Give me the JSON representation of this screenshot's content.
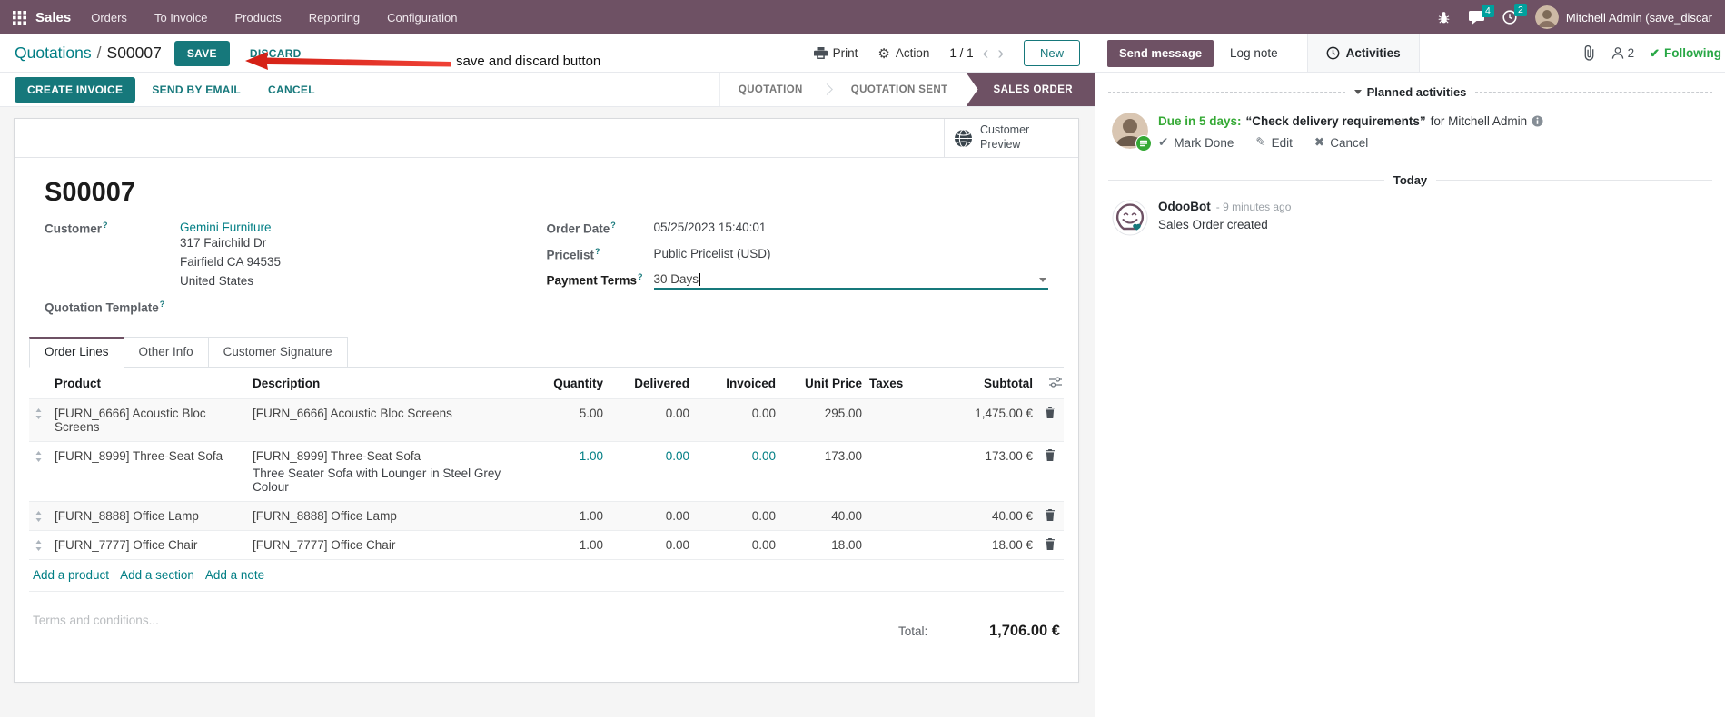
{
  "nav": {
    "app_label": "Sales",
    "menus": [
      {
        "label": "Orders"
      },
      {
        "label": "To Invoice"
      },
      {
        "label": "Products"
      },
      {
        "label": "Reporting"
      },
      {
        "label": "Configuration"
      }
    ],
    "messages_badge": "4",
    "activities_badge": "2",
    "user_name": "Mitchell Admin (save_discar"
  },
  "control": {
    "breadcrumb_parent": "Quotations",
    "breadcrumb_sep": "/",
    "breadcrumb_current": "S00007",
    "save": "SAVE",
    "discard": "DISCARD",
    "print": "Print",
    "action": "Action",
    "pager": "1 / 1",
    "new": "New"
  },
  "annotation": {
    "label": "save and discard button"
  },
  "actions": {
    "create_invoice": "CREATE INVOICE",
    "send_by_email": "SEND BY EMAIL",
    "cancel": "CANCEL"
  },
  "statusbar": {
    "step1": "QUOTATION",
    "step2": "QUOTATION SENT",
    "step3": "SALES ORDER"
  },
  "sheet": {
    "customer_preview": "Customer Preview",
    "name": "S00007",
    "help_marker": "?",
    "customer_label": "Customer",
    "customer": "Gemini Furniture",
    "address_line1": "317 Fairchild Dr",
    "address_line2": "Fairfield CA 94535",
    "address_line3": "United States",
    "quotation_template_label": "Quotation Template",
    "order_date_label": "Order Date",
    "order_date": "05/25/2023 15:40:01",
    "pricelist_label": "Pricelist",
    "pricelist": "Public Pricelist (USD)",
    "payment_terms_label": "Payment Terms",
    "payment_terms": "30 Days"
  },
  "tabs": {
    "order_lines": "Order Lines",
    "other_info": "Other Info",
    "customer_signature": "Customer Signature"
  },
  "order_lines": {
    "columns": {
      "product": "Product",
      "description": "Description",
      "quantity": "Quantity",
      "delivered": "Delivered",
      "invoiced": "Invoiced",
      "unit_price": "Unit Price",
      "taxes": "Taxes",
      "subtotal": "Subtotal"
    },
    "rows": [
      {
        "product": "[FURN_6666] Acoustic Bloc Screens",
        "description": "[FURN_6666] Acoustic Bloc Screens",
        "description2": "",
        "quantity": "5.00",
        "delivered": "0.00",
        "invoiced": "0.00",
        "unit_price": "295.00",
        "taxes": "",
        "subtotal": "1,475.00 €"
      },
      {
        "product": "[FURN_8999] Three-Seat Sofa",
        "description": "[FURN_8999] Three-Seat Sofa",
        "description2": "Three Seater Sofa with Lounger in Steel Grey Colour",
        "quantity": "1.00",
        "delivered": "0.00",
        "invoiced": "0.00",
        "unit_price": "173.00",
        "taxes": "",
        "subtotal": "173.00 €"
      },
      {
        "product": "[FURN_8888] Office Lamp",
        "description": "[FURN_8888] Office Lamp",
        "description2": "",
        "quantity": "1.00",
        "delivered": "0.00",
        "invoiced": "0.00",
        "unit_price": "40.00",
        "taxes": "",
        "subtotal": "40.00 €"
      },
      {
        "product": "[FURN_7777] Office Chair",
        "description": "[FURN_7777] Office Chair",
        "description2": "",
        "quantity": "1.00",
        "delivered": "0.00",
        "invoiced": "0.00",
        "unit_price": "18.00",
        "taxes": "",
        "subtotal": "18.00 €"
      }
    ],
    "add_product": "Add a product",
    "add_section": "Add a section",
    "add_note": "Add a note"
  },
  "footer": {
    "terms_placeholder": "Terms and conditions...",
    "total_label": "Total:",
    "total_value": "1,706.00 €"
  },
  "chatter": {
    "send_message": "Send message",
    "log_note": "Log note",
    "activities": "Activities",
    "followers_count": "2",
    "following": "Following",
    "planned_header": "Planned activities",
    "activity": {
      "due": "Due in 5 days:",
      "title": "“Check delivery requirements”",
      "assignee": "for Mitchell Admin",
      "mark_done": "Mark Done",
      "edit": "Edit",
      "cancel": "Cancel"
    },
    "today": "Today",
    "message": {
      "author": "OdooBot",
      "time": "- 9 minutes ago",
      "body": "Sales Order created"
    }
  },
  "colors": {
    "brand": "#6e5164",
    "accent": "#017e84",
    "badge": "#00a09d",
    "success": "#28a745",
    "annotation_arrow": "#e0251b"
  }
}
